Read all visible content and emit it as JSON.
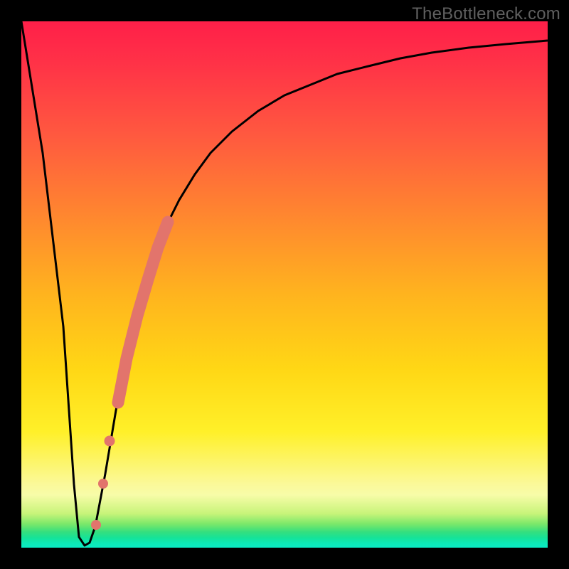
{
  "watermark": {
    "text": "TheBottleneck.com"
  },
  "colors": {
    "frame": "#000000",
    "curve": "#000000",
    "marker": "#e2746c",
    "gradient_stops": [
      "#ff1f49",
      "#ff3247",
      "#ff5a3f",
      "#ff8a2e",
      "#ffb41e",
      "#ffd715",
      "#fff029",
      "#fbf99a",
      "#f7fca8",
      "#c8f47a",
      "#7be86a",
      "#35df7e",
      "#14e39a",
      "#0de9b6",
      "#0bebc4"
    ]
  },
  "chart_data": {
    "type": "line",
    "title": "",
    "xlabel": "",
    "ylabel": "",
    "xlim": [
      0,
      100
    ],
    "ylim": [
      0,
      100
    ],
    "series": [
      {
        "name": "bottleneck-curve",
        "x": [
          0,
          4,
          8,
          10,
          11,
          12,
          14,
          16,
          18,
          20,
          22,
          24,
          26,
          28,
          30,
          33,
          36,
          40,
          45,
          50,
          55,
          60,
          66,
          72,
          78,
          85,
          92,
          100
        ],
        "values": [
          100,
          75,
          42,
          12,
          2,
          0,
          4,
          14,
          26,
          36,
          44,
          51,
          57,
          62,
          66,
          71,
          75,
          79,
          83,
          86,
          88,
          90,
          91.5,
          93,
          94,
          95,
          95.7,
          96.3
        ]
      }
    ],
    "markers": {
      "name": "highlight-strip",
      "description": "thick salmon segment on rising branch of curve",
      "strip": {
        "x_start": 18,
        "x_end": 28
      },
      "dots": [
        {
          "x": 16.8,
          "y_pct": 20
        },
        {
          "x": 15.6,
          "y_pct": 12
        },
        {
          "x": 14.2,
          "y_pct": 4
        }
      ],
      "color": "#e2746c"
    }
  }
}
